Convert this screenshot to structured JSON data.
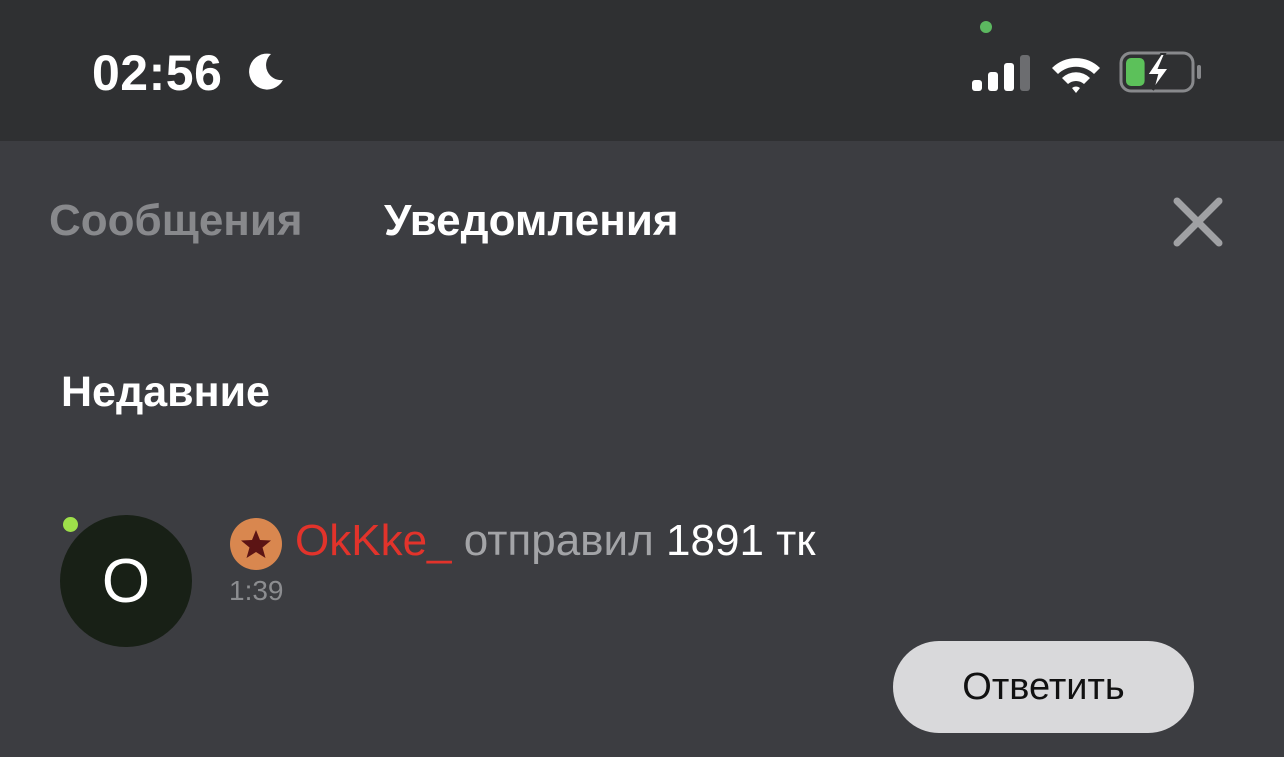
{
  "status_bar": {
    "time": "02:56",
    "focus_icon": "moon-icon",
    "signal_icon": "cellular-signal-icon",
    "wifi_icon": "wifi-icon",
    "battery_icon": "battery-charging-icon",
    "battery_level": 0.3,
    "privacy_dot_color": "#5cb860"
  },
  "tabs": [
    {
      "label": "Сообщения",
      "active": false
    },
    {
      "label": "Уведомления",
      "active": true
    }
  ],
  "close_icon": "close-icon",
  "section": {
    "title": "Недавние"
  },
  "notification": {
    "avatar_letter": "O",
    "online_color": "#9ee04a",
    "badge_icon": "star-badge-icon",
    "badge_color": "#d9874f",
    "username": "OkKke_",
    "username_color": "#e2332b",
    "action": "отправил",
    "amount": "1891 тк",
    "time": "1:39",
    "reply_label": "Ответить"
  }
}
